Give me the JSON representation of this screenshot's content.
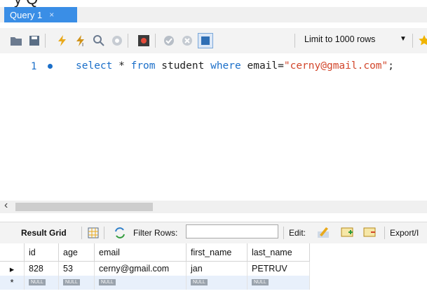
{
  "tabs": [
    {
      "label": "Query 1",
      "close": "×"
    }
  ],
  "toolbar": {
    "limit_label": "Limit to 1000 rows"
  },
  "editor": {
    "line_number": "1",
    "sql_kw1": "select",
    "sql_mid1": " * ",
    "sql_kw2": "from",
    "sql_mid2": " student ",
    "sql_kw3": "where",
    "sql_mid3": " email=",
    "sql_str": "\"cerny@gmail.com\"",
    "sql_end": ";"
  },
  "result_toolbar": {
    "result_grid": "Result Grid",
    "filter_rows": "Filter Rows:",
    "edit": "Edit:",
    "export": "Export/I"
  },
  "grid": {
    "columns": [
      "id",
      "age",
      "email",
      "first_name",
      "last_name"
    ],
    "row": {
      "id": "828",
      "age": "53",
      "email": "cerny@gmail.com",
      "first_name": "jan",
      "last_name": "PETRUV"
    },
    "null_label": "NULL"
  },
  "colors": {
    "tab_bg": "#3a8ee6",
    "keyword": "#1b6fc9",
    "string": "#d2462b"
  }
}
